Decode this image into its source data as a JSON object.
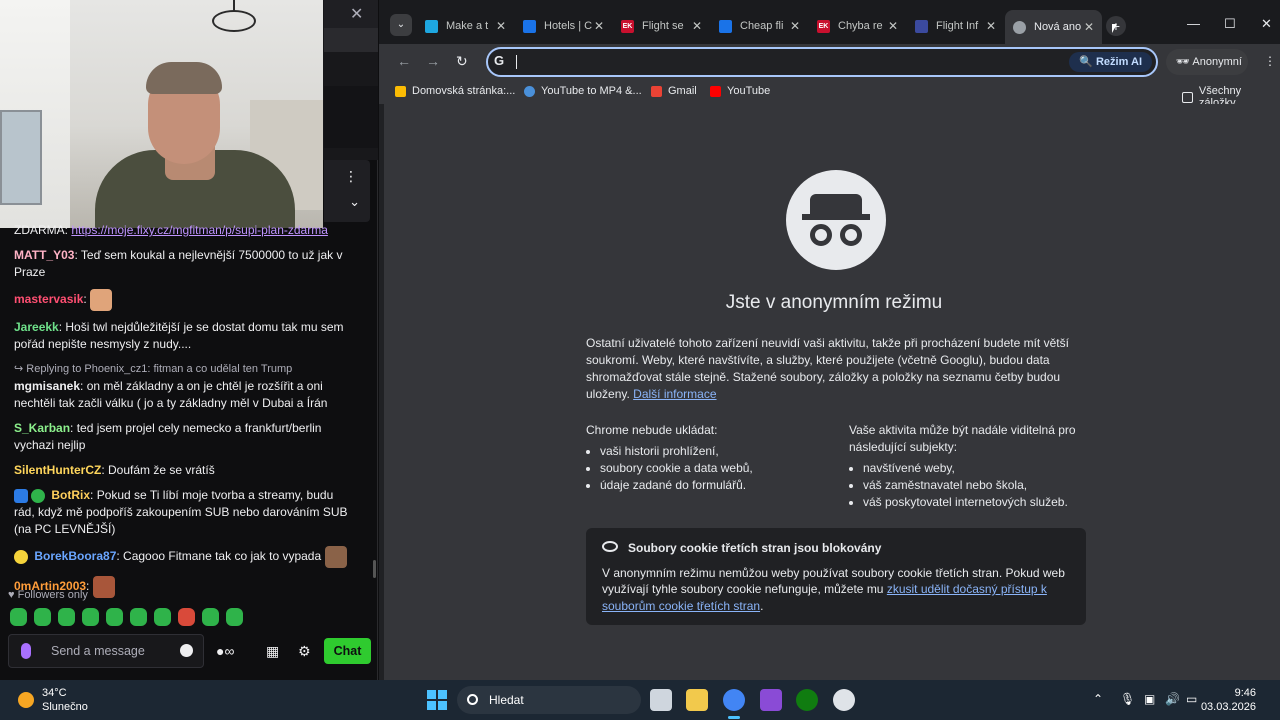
{
  "chat": {
    "messages": [
      {
        "user": "",
        "text": "ZDARMA: ",
        "link": "https://moje.fixy.cz/mgfitman/p/supi-plan-zdarma"
      },
      {
        "user": "MATT_Y03",
        "user_color": "#ffb3c6",
        "text": "Teď sem koukal a nejlevnější 7500000 to už jak v Praze"
      },
      {
        "user": "mastervasik",
        "user_color": "#ff4f72",
        "text": ""
      },
      {
        "user": "Jareekk",
        "user_color": "#6ee08a",
        "text": "Hoši twl nejdůležitější je se dostat domu tak mu sem pořád nepište nesmysly z nudy...."
      },
      {
        "reply": "Replying to Phoenix_cz1: fitman a co udělal ten Trump",
        "user": "mgmisanek",
        "user_color": "#efeff1",
        "text": "on měl základny a on je chtěl je rozšířit a oni nechtěli tak začli válku ( jo a ty základny měl v Dubai a Írán"
      },
      {
        "user": "S_Karban",
        "user_color": "#8cf08c",
        "text": "ted jsem projel cely nemecko a frankfurt/berlin vychazi nejlip"
      },
      {
        "user": "SilentHunterCZ",
        "user_color": "#ffd65c",
        "text": "Doufám že se vrátíš"
      },
      {
        "user": "BotRix",
        "user_color": "#ffcf5c",
        "text": "Pokud se Ti líbí moje tvorba a streamy, budu rád, když mě podpoříš zakoupením SUB nebo darováním SUB (na PC LEVNĚJŠÍ)"
      },
      {
        "user": "BorekBoora87",
        "user_color": "#6aa6ff",
        "text": "Cagooo Fitmane tak co jak to vypada"
      },
      {
        "user": "0mArtin2003",
        "user_color": "#ff9d3a",
        "text": ""
      }
    ],
    "followers_only": "Followers only",
    "input_placeholder": "Send a message",
    "chat_button": "Chat"
  },
  "browser": {
    "tabs": [
      {
        "title": "Make a t",
        "fav_color": "#1ea7e0",
        "fav_text": ""
      },
      {
        "title": "Hotels | C",
        "fav_color": "#1a73e8",
        "fav_text": ""
      },
      {
        "title": "Flight se",
        "fav_color": "#c8102e",
        "fav_text": "EK"
      },
      {
        "title": "Cheap fli",
        "fav_color": "#1a73e8",
        "fav_text": ""
      },
      {
        "title": "Chyba re",
        "fav_color": "#c8102e",
        "fav_text": "EK"
      },
      {
        "title": "Flight Inf",
        "fav_color": "#3b4a9e",
        "fav_text": ""
      },
      {
        "title": "Nová ano",
        "fav_color": "#9aa0a6",
        "fav_text": ""
      }
    ],
    "ai_mode": "Režim AI",
    "incognito_label": "Anonymní",
    "bookmarks": [
      {
        "label": "Domovská stránka:...",
        "color": "#fbbc04"
      },
      {
        "label": "YouTube to MP4 &...",
        "color": "#4a90d9"
      },
      {
        "label": "Gmail",
        "color": "#ea4335"
      },
      {
        "label": "YouTube",
        "color": "#ff0000"
      }
    ],
    "all_bookmarks": "Všechny záložky",
    "page": {
      "heading": "Jste v anonymním režimu",
      "intro": "Ostatní uživatelé tohoto zařízení neuvidí vaši aktivitu, takže při procházení budete mít větší soukromí. Weby, které navštívíte, a služby, které použijete (včetně Googlu), budou data shromažďovat stále stejně. Stažené soubory, záložky a položky na seznamu četby budou uloženy.",
      "more_info": "Další informace",
      "left_title": "Chrome nebude ukládat:",
      "left_items": [
        "vaši historii prohlížení,",
        "soubory cookie a data webů,",
        "údaje zadané do formulářů."
      ],
      "right_title": "Vaše aktivita může být nadále viditelná pro následující subjekty:",
      "right_items": [
        "navštívené weby,",
        "váš zaměstnavatel nebo škola,",
        "váš poskytovatel internetových služeb."
      ],
      "cookie_title": "Soubory cookie třetích stran jsou blokovány",
      "cookie_text": "V anonymním režimu nemůžou weby používat soubory cookie třetích stran. Pokud web využívají tyhle soubory cookie nefunguje, můžete mu ",
      "cookie_link": "zkusit udělit dočasný přístup k souborům cookie třetích stran",
      "cookie_end": "."
    }
  },
  "taskbar": {
    "temperature": "34°C",
    "weather": "Slunečno",
    "search_label": "Hledat",
    "time": "9:46",
    "date": "03.03.2026"
  }
}
